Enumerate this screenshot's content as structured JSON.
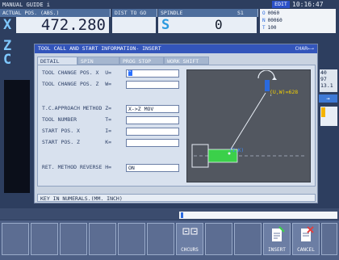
{
  "header": {
    "mode": "MANUAL GUIDE i",
    "status": "EDIT",
    "time": "10:16:47"
  },
  "tabs": {
    "actual_pos": "ACTUAL POS. (ABS.)",
    "dist_to_go": "DIST TO GO",
    "spindle": "SPINDLE",
    "spindle_num": "S1"
  },
  "position": {
    "axes": [
      "X",
      "Z",
      "C"
    ],
    "x_value": "472.280",
    "spindle_letter": "S",
    "spindle_value": "0"
  },
  "onf": [
    {
      "key": "O",
      "val": "0060"
    },
    {
      "key": "N",
      "val": "00060"
    },
    {
      "key": "T",
      "val": "100"
    }
  ],
  "right_panel": {
    "values": [
      "40",
      "97",
      "13.1"
    ],
    "arrow": "→"
  },
  "dialog": {
    "title": "TOOL CALL AND START INFORMATION- INSERT",
    "char_mode": "CHAR←→",
    "tabs": [
      "DETAIL",
      "SPIN",
      "PROG STOP",
      "WORK SHIFT"
    ],
    "active_tab": "DETAIL",
    "fields": [
      {
        "label": "TOOL CHANGE POS. X  U=",
        "value": "^"
      },
      {
        "label": "TOOL CHANGE POS. Z  W=",
        "value": ""
      },
      {
        "label": "T.C.APPROACH METHOD Z=",
        "value": "X->Z MOV"
      },
      {
        "label": "TOOL NUMBER         T=",
        "value": ""
      },
      {
        "label": "START POS. X        I=",
        "value": ""
      },
      {
        "label": "START POS. Z        K=",
        "value": ""
      },
      {
        "label": "RET. METHOD REVERSE H=",
        "value": "ON"
      }
    ],
    "graphic": {
      "label_uw": "(U,W)=628",
      "label_ik": "(I,K)"
    },
    "message": "KEY IN NUMERALS.(MM. INCH)"
  },
  "softkeys": {
    "chcurs": "CHCURS",
    "insert": "INSERT",
    "cancel": "CANCEL"
  },
  "colors": {
    "accent": "#3355bb",
    "axis": "#7fc8ff",
    "background": "#2d3e5f",
    "dialog": "#c9d3e1"
  }
}
